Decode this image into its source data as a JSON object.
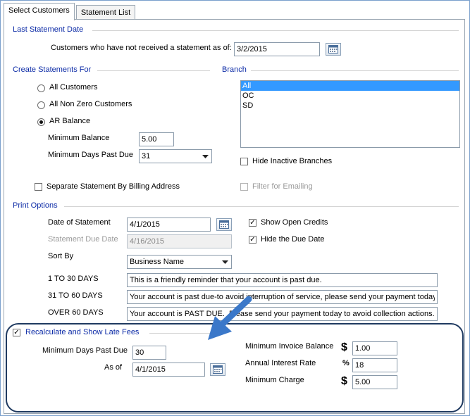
{
  "tabs": [
    {
      "label": "Select Customers",
      "active": true
    },
    {
      "label": "Statement List",
      "active": false
    }
  ],
  "last_statement": {
    "group_label": "Last Statement Date",
    "label": "Customers who have not received a statement as of:",
    "value": "3/2/2015"
  },
  "create_for": {
    "group_label": "Create Statements For",
    "options": [
      {
        "label": "All Customers",
        "checked": false
      },
      {
        "label": "All Non Zero Customers",
        "checked": false
      },
      {
        "label": "AR Balance",
        "checked": true
      }
    ],
    "min_balance_label": "Minimum Balance",
    "min_balance_value": "5.00",
    "min_days_label": "Minimum Days Past Due",
    "min_days_value": "31",
    "separate_label": "Separate Statement By Billing Address",
    "separate_checked": false
  },
  "branch": {
    "group_label": "Branch",
    "items": [
      {
        "label": "All",
        "selected": true
      },
      {
        "label": "OC",
        "selected": false
      },
      {
        "label": "SD",
        "selected": false
      }
    ],
    "hide_inactive_label": "Hide Inactive Branches",
    "hide_inactive_checked": false,
    "filter_email_label": "Filter for Emailing",
    "filter_email_checked": false
  },
  "print_options": {
    "group_label": "Print Options",
    "date_label": "Date of Statement",
    "date_value": "4/1/2015",
    "due_label": "Statement Due Date",
    "due_value": "4/16/2015",
    "sort_label": "Sort By",
    "sort_value": "Business Name",
    "show_open_credits_label": "Show Open Credits",
    "show_open_credits_checked": true,
    "hide_due_label": "Hide the Due Date",
    "hide_due_checked": true,
    "msg1_label": "1 TO 30 DAYS",
    "msg1_value": "This is a friendly reminder that your account is past due.",
    "msg2_label": "31 TO 60 DAYS",
    "msg2_value": "Your account is past due-to avoid interruption of service, please send your payment today",
    "msg3_label": "OVER 60 DAYS",
    "msg3_value": "Your account is PAST DUE.  Please send your payment today to avoid collection actions."
  },
  "late_fees": {
    "label": "Recalculate and Show Late Fees",
    "checked": true,
    "min_days_label": "Minimum Days Past Due",
    "min_days_value": "30",
    "as_of_label": "As of",
    "as_of_value": "4/1/2015",
    "min_invoice_label": "Minimum Invoice Balance",
    "min_invoice_symbol": "$",
    "min_invoice_value": "1.00",
    "interest_label": "Annual Interest Rate",
    "interest_symbol": "%",
    "interest_value": "18",
    "min_charge_label": "Minimum Charge",
    "min_charge_symbol": "$",
    "min_charge_value": "5.00"
  },
  "colors": {
    "group_label": "#0b2aa6",
    "callout_arrow": "#3b78c9",
    "highlight_border": "#1f3a60",
    "selection": "#3399ff"
  }
}
